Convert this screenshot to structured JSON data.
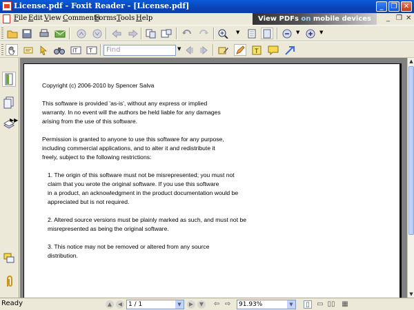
{
  "window": {
    "title": "License.pdf - Foxit Reader - [License.pdf]",
    "minimize": "_",
    "maximize": "❐",
    "close": "✕"
  },
  "menu": {
    "items": [
      "File",
      "Edit",
      "View",
      "Comments",
      "Forms",
      "Tools",
      "Help"
    ],
    "banner_part1": "View PDFs ",
    "banner_accent": "on",
    "banner_part2": " mobile devices",
    "mdi_minimize": "_",
    "mdi_restore": "❐",
    "mdi_close": "✕"
  },
  "toolbar": {
    "find_placeholder": "Find"
  },
  "document": {
    "lines": [
      "Copyright (c) 2006-2010 by Spencer Salva",
      "This software is provided 'as-is', without any express or implied",
      "warranty. In no event will the authors be held liable for any damages",
      "arising from the use of this software.",
      "Permission is granted to anyone to use this software for any purpose,",
      "including commercial applications, and to alter it and redistribute it",
      "freely, subject to the following restrictions:",
      "1. The origin of this software must not be misrepresented; you must not",
      "claim that you wrote the original software. If you use this software",
      "in a product, an acknowledgment in the product documentation would be",
      "appreciated but is not required.",
      "2. Altered source versions must be plainly marked as such, and must not be",
      "misrepresented as being the original software.",
      "3. This notice may not be removed or altered from any source",
      "distribution."
    ]
  },
  "status": {
    "ready": "Ready",
    "page": "1 / 1",
    "zoom": "91.93%"
  },
  "colors": {
    "titlebar": "#0845b8",
    "chrome": "#ece9d8",
    "doc_background": "#808080"
  }
}
